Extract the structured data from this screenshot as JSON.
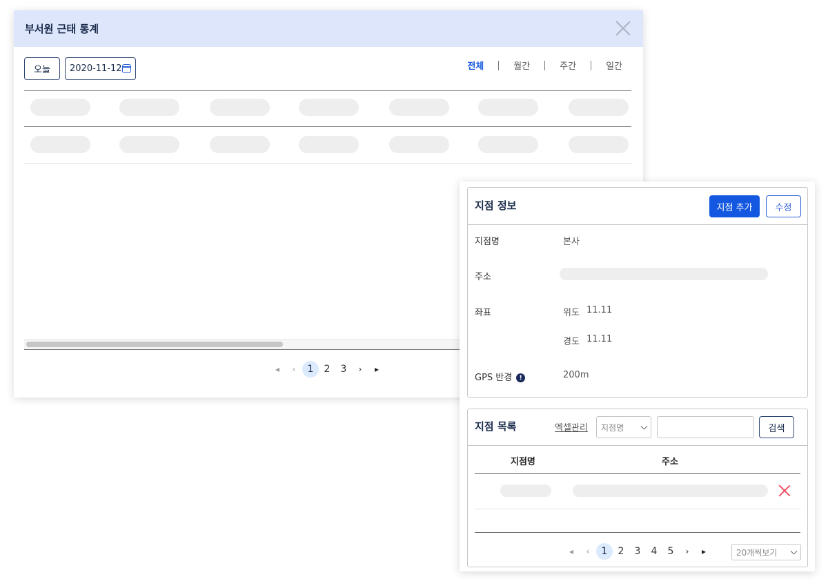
{
  "stats_modal": {
    "title": "부서원 근태 통계",
    "today_button": "오늘",
    "date_value": "2020-11-12",
    "period_tabs": [
      {
        "label": "전체",
        "active": true
      },
      {
        "label": "월간",
        "active": false
      },
      {
        "label": "주간",
        "active": false
      },
      {
        "label": "일간",
        "active": false
      }
    ],
    "pagination": {
      "pages": [
        "1",
        "2",
        "3"
      ],
      "current": "1"
    }
  },
  "branch_info": {
    "title": "지점 정보",
    "add_button": "지점 추가",
    "edit_button": "수정",
    "fields": {
      "name_label": "지점명",
      "name_value": "본사",
      "address_label": "주소",
      "coord_label": "좌표",
      "lat_label": "위도",
      "lat_value": "11.11",
      "lng_label": "경도",
      "lng_value": "11.11",
      "gps_label": "GPS 반경",
      "gps_info_icon": "!",
      "gps_value": "200m"
    }
  },
  "branch_list": {
    "title": "지점 목록",
    "excel_link": "엑셀관리",
    "search_field_select": "지점명",
    "search_input_value": "",
    "search_button": "검색",
    "columns": [
      "지점명",
      "주소"
    ],
    "pagination": {
      "pages": [
        "1",
        "2",
        "3",
        "4",
        "5"
      ],
      "current": "1"
    },
    "page_size_select": "20개씩보기"
  },
  "colors": {
    "primary": "#1457e0",
    "header_bg": "#dde6fb",
    "navy": "#1a2a4a",
    "delete_red": "#ef4f63",
    "skeleton": "#eeeeee"
  }
}
